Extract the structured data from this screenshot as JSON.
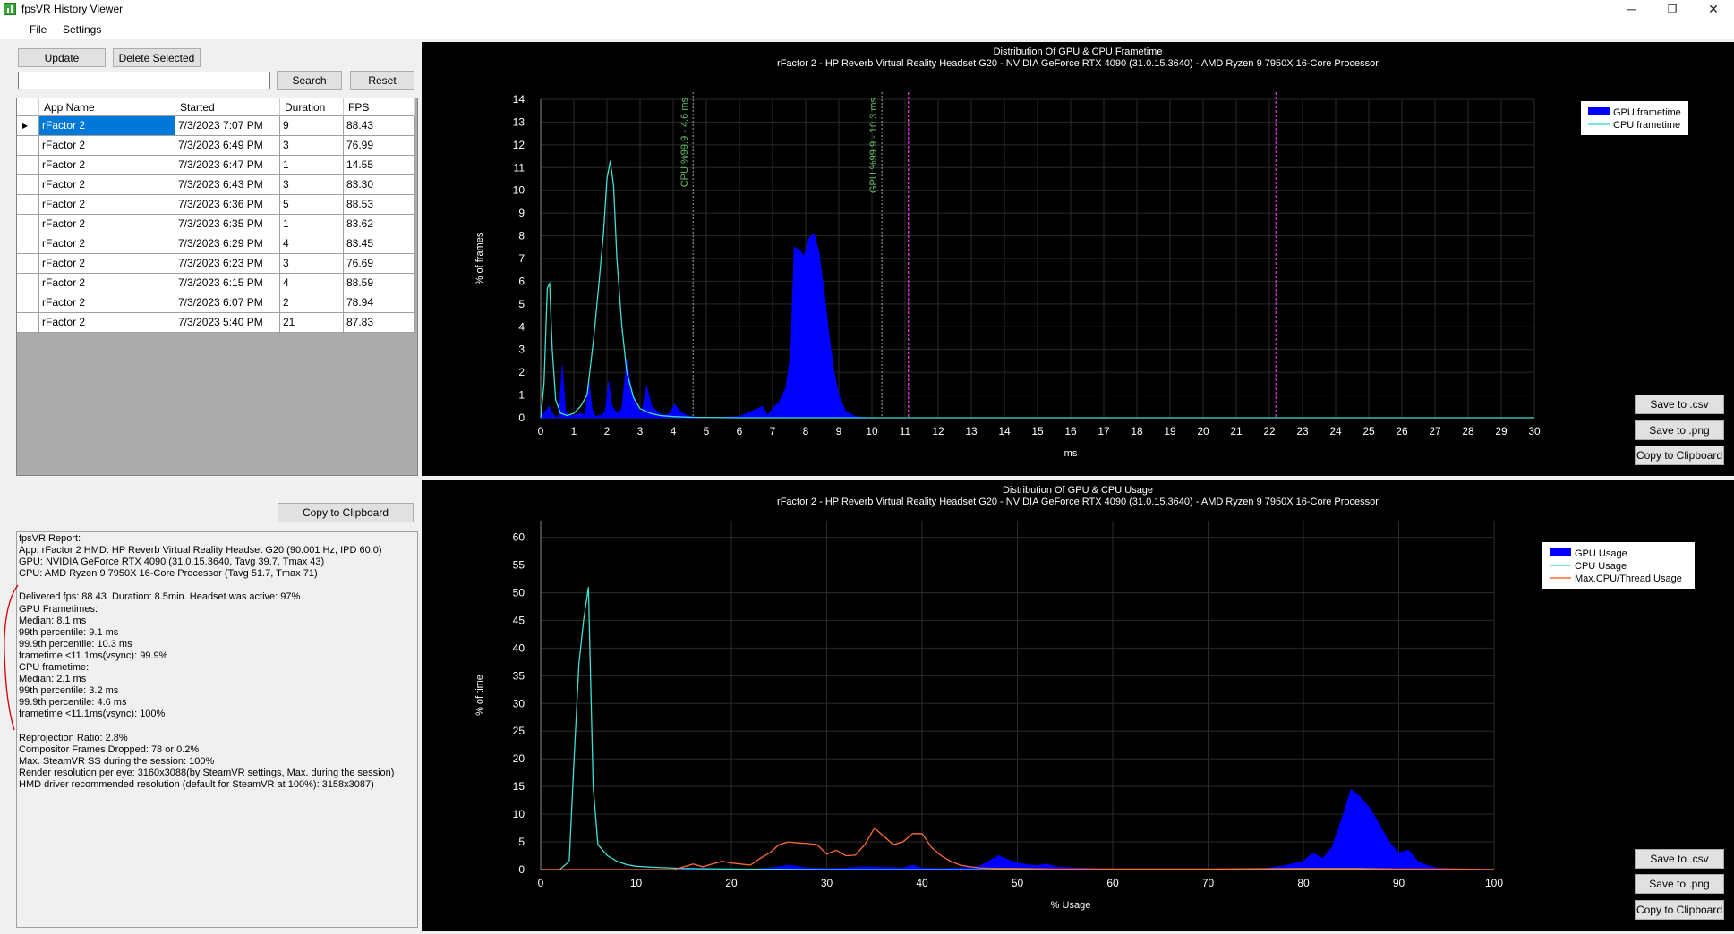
{
  "window": {
    "title": "fpsVR History Viewer",
    "minimize": "─",
    "maximize": "❐",
    "close": "✕"
  },
  "menu": {
    "file": "File",
    "settings": "Settings"
  },
  "toolbar": {
    "update": "Update",
    "delete": "Delete Selected",
    "search": "Search",
    "reset": "Reset",
    "search_value": ""
  },
  "grid": {
    "columns": [
      "App Name",
      "Started",
      "Duration",
      "FPS"
    ],
    "rows": [
      [
        "rFactor 2",
        "7/3/2023 7:07 PM",
        "9",
        "88.43"
      ],
      [
        "rFactor 2",
        "7/3/2023 6:49 PM",
        "3",
        "76.99"
      ],
      [
        "rFactor 2",
        "7/3/2023 6:47 PM",
        "1",
        "14.55"
      ],
      [
        "rFactor 2",
        "7/3/2023 6:43 PM",
        "3",
        "83.30"
      ],
      [
        "rFactor 2",
        "7/3/2023 6:36 PM",
        "5",
        "88.53"
      ],
      [
        "rFactor 2",
        "7/3/2023 6:35 PM",
        "1",
        "83.62"
      ],
      [
        "rFactor 2",
        "7/3/2023 6:29 PM",
        "4",
        "83.45"
      ],
      [
        "rFactor 2",
        "7/3/2023 6:23 PM",
        "3",
        "76.69"
      ],
      [
        "rFactor 2",
        "7/3/2023 6:15 PM",
        "4",
        "88.59"
      ],
      [
        "rFactor 2",
        "7/3/2023 6:07 PM",
        "2",
        "78.94"
      ],
      [
        "rFactor 2",
        "7/3/2023 5:40 PM",
        "21",
        "87.83"
      ]
    ],
    "selected_row": 0
  },
  "report": {
    "copy_button": "Copy to Clipboard",
    "lines": [
      "fpsVR Report:",
      "App: rFactor 2 HMD: HP Reverb Virtual Reality Headset G20 (90.001 Hz, IPD 60.0)",
      "GPU: NVIDIA GeForce RTX 4090 (31.0.15.3640, Tavg 39.7, Tmax 43)",
      "CPU: AMD Ryzen 9 7950X 16-Core Processor (Tavg 51.7, Tmax 71)",
      "",
      "Delivered fps: 88.43  Duration: 8.5min. Headset was active: 97%",
      "GPU Frametimes:",
      "Median: 8.1 ms",
      "99th percentile: 9.1 ms",
      "99.9th percentile: 10.3 ms",
      "frametime <11.1ms(vsync): 99.9%",
      "CPU frametime:",
      "Median: 2.1 ms",
      "99th percentile: 3.2 ms",
      "99.9th percentile: 4.6 ms",
      "frametime <11.1ms(vsync): 100%",
      "",
      "Reprojection Ratio: 2.8%",
      "Compositor Frames Dropped: 78 or 0.2%",
      "Max. SteamVR SS during the session: 100%",
      "Render resolution per eye: 3160x3088(by SteamVR settings, Max. during the session)",
      "HMD driver recommended resolution (default for SteamVR at 100%): 3158x3087)"
    ]
  },
  "chart_buttons": {
    "csv": "Save to .csv",
    "png": "Save to .png",
    "clipboard": "Copy to Clipboard"
  },
  "colors": {
    "gpu": "#0000ff",
    "cpu": "#40e0d0",
    "max_thread": "#ff6a33",
    "vsync_line": "#cc33cc",
    "percentile_line": "#66bb66",
    "grid": "#2a2a2a",
    "axis_text": "#ffffff",
    "annotation_red": "#d40000"
  },
  "chart_data": [
    {
      "type": "area",
      "title": "Distribution Of GPU & CPU Frametime",
      "subtitle": "rFactor 2 - HP Reverb Virtual Reality Headset G20 - NVIDIA GeForce RTX 4090 (31.0.15.3640) - AMD Ryzen 9 7950X 16-Core Processor",
      "xlabel": "ms",
      "ylabel": "% of frames",
      "xlim": [
        0,
        30
      ],
      "ylim": [
        0,
        14
      ],
      "x_ticks": [
        0,
        1,
        2,
        3,
        4,
        5,
        6,
        7,
        8,
        9,
        10,
        11,
        12,
        13,
        14,
        15,
        16,
        17,
        18,
        19,
        20,
        21,
        22,
        23,
        24,
        25,
        26,
        27,
        28,
        29,
        30
      ],
      "y_ticks": [
        0,
        1,
        2,
        3,
        4,
        5,
        6,
        7,
        8,
        9,
        10,
        11,
        12,
        13,
        14
      ],
      "grid": true,
      "legend": "top-right",
      "series": [
        {
          "name": "GPU frametime",
          "style": "filled",
          "x": [
            0,
            0.15,
            0.25,
            0.35,
            0.45,
            0.55,
            0.65,
            0.75,
            0.85,
            1.0,
            1.2,
            1.35,
            1.45,
            1.55,
            1.65,
            1.75,
            1.85,
            1.95,
            2.05,
            2.15,
            2.3,
            2.45,
            2.6,
            2.75,
            2.85,
            2.95,
            3.05,
            3.2,
            3.35,
            3.5,
            3.6,
            3.75,
            3.9,
            4.05,
            4.2,
            4.4,
            4.6,
            5.0,
            6.0,
            6.7,
            6.85,
            7.0,
            7.2,
            7.4,
            7.55,
            7.65,
            7.8,
            7.95,
            8.1,
            8.25,
            8.4,
            8.55,
            8.7,
            8.85,
            9.0,
            9.2,
            9.5,
            10,
            30
          ],
          "y": [
            0,
            0.3,
            0.5,
            0.2,
            0,
            0.05,
            2.3,
            0.3,
            0.1,
            0.1,
            0.2,
            0.1,
            1.7,
            0.4,
            0.05,
            0.1,
            0.1,
            0.3,
            1.6,
            0.5,
            0.2,
            0.4,
            2.6,
            1.0,
            0.8,
            0.4,
            0.2,
            1.4,
            0.5,
            0.3,
            0.2,
            0.1,
            0.2,
            0.6,
            0.3,
            0.1,
            0.05,
            0,
            0.05,
            0.5,
            0.1,
            0.4,
            0.7,
            1.3,
            2.8,
            7.5,
            7.4,
            7.1,
            7.9,
            8.1,
            7.3,
            5.6,
            3.7,
            2.1,
            1.0,
            0.3,
            0.05,
            0,
            0
          ]
        },
        {
          "name": "CPU frametime",
          "style": "line",
          "x": [
            0,
            0.1,
            0.2,
            0.27,
            0.35,
            0.45,
            0.6,
            0.8,
            1.0,
            1.2,
            1.4,
            1.6,
            1.75,
            1.9,
            2.0,
            2.1,
            2.2,
            2.3,
            2.45,
            2.6,
            2.8,
            3.0,
            3.3,
            3.6,
            4.0,
            4.6,
            6,
            30
          ],
          "y": [
            0,
            1.5,
            5.7,
            5.9,
            3.0,
            0.8,
            0.2,
            0.1,
            0.2,
            0.5,
            1.0,
            3.5,
            5.8,
            8.2,
            10.5,
            11.3,
            10.2,
            7.0,
            4.0,
            2.0,
            0.9,
            0.4,
            0.2,
            0.1,
            0.05,
            0.02,
            0,
            0
          ]
        }
      ],
      "annotations": [
        {
          "type": "vline",
          "x": 4.6,
          "label": "CPU %99.9 - 4.6 ms"
        },
        {
          "type": "vline",
          "x": 10.3,
          "label": "GPU %99.9 - 10.3 ms"
        },
        {
          "type": "vline",
          "x": 11.1,
          "label": ""
        },
        {
          "type": "vline",
          "x": 22.2,
          "label": ""
        }
      ]
    },
    {
      "type": "area",
      "title": "Distribution Of GPU & CPU Usage",
      "subtitle": "rFactor 2 - HP Reverb Virtual Reality Headset G20 - NVIDIA GeForce RTX 4090 (31.0.15.3640) - AMD Ryzen 9 7950X 16-Core Processor",
      "xlabel": "% Usage",
      "ylabel": "% of time",
      "xlim": [
        0,
        100
      ],
      "ylim": [
        0,
        63
      ],
      "x_ticks": [
        0,
        10,
        20,
        30,
        40,
        50,
        60,
        70,
        80,
        90,
        100
      ],
      "y_ticks": [
        0,
        5,
        10,
        15,
        20,
        25,
        30,
        35,
        40,
        45,
        50,
        55,
        60
      ],
      "grid": true,
      "legend": "top-right",
      "series": [
        {
          "name": "GPU Usage",
          "style": "filled",
          "x": [
            0,
            22,
            24,
            26,
            28,
            30,
            32,
            34,
            36,
            38,
            39,
            40,
            42,
            44,
            46,
            47,
            48,
            49,
            50,
            51,
            52,
            53,
            54,
            56,
            58,
            60,
            70,
            76,
            78,
            80,
            81,
            82,
            83,
            84,
            85,
            86,
            87,
            88,
            89,
            90,
            91,
            92,
            93,
            94,
            96,
            100
          ],
          "y": [
            0,
            0,
            0.3,
            0.8,
            0.3,
            0.2,
            0.3,
            0.5,
            0.4,
            0.3,
            0.8,
            0.3,
            0.2,
            0.3,
            0.6,
            1.5,
            2.5,
            1.8,
            1.2,
            0.9,
            0.7,
            1.0,
            0.5,
            0.3,
            0.2,
            0.1,
            0,
            0.2,
            0.7,
            1.5,
            3.0,
            2.0,
            4.0,
            9.0,
            14.5,
            13.0,
            11.0,
            8.0,
            5.0,
            3.0,
            3.5,
            1.5,
            0.7,
            0.3,
            0.1,
            0
          ]
        },
        {
          "name": "CPU Usage",
          "style": "line",
          "x": [
            0,
            2,
            3,
            3.5,
            4,
            4.5,
            5,
            5.5,
            6,
            7,
            8,
            9,
            10,
            12,
            15,
            20,
            30,
            100
          ],
          "y": [
            0,
            0,
            1.5,
            20,
            37,
            45,
            51,
            15,
            4.5,
            2.5,
            1.5,
            0.9,
            0.6,
            0.4,
            0.2,
            0.1,
            0,
            0
          ]
        },
        {
          "name": "Max.CPU/Thread Usage",
          "style": "line",
          "x": [
            0,
            14,
            15,
            16,
            17,
            18,
            19,
            20,
            21,
            22,
            23,
            24,
            25,
            26,
            27,
            28,
            29,
            30,
            31,
            32,
            33,
            34,
            35,
            36,
            37,
            38,
            39,
            40,
            41,
            42,
            43,
            44,
            45,
            46,
            48,
            50,
            54,
            60,
            70,
            80,
            86,
            90,
            96,
            100
          ],
          "y": [
            0,
            0,
            0.5,
            1.0,
            0.5,
            1.0,
            1.5,
            1.2,
            1.0,
            0.8,
            2.0,
            3.0,
            4.5,
            5.0,
            4.8,
            4.7,
            4.5,
            2.8,
            3.5,
            2.5,
            2.6,
            4.5,
            7.5,
            6.0,
            4.5,
            5.0,
            6.5,
            6.5,
            4.0,
            2.5,
            1.5,
            0.8,
            0.5,
            0.3,
            0.2,
            0.2,
            0.1,
            0.1,
            0.1,
            0.2,
            0.2,
            0.1,
            0.1,
            0
          ]
        }
      ],
      "annotations": []
    }
  ]
}
